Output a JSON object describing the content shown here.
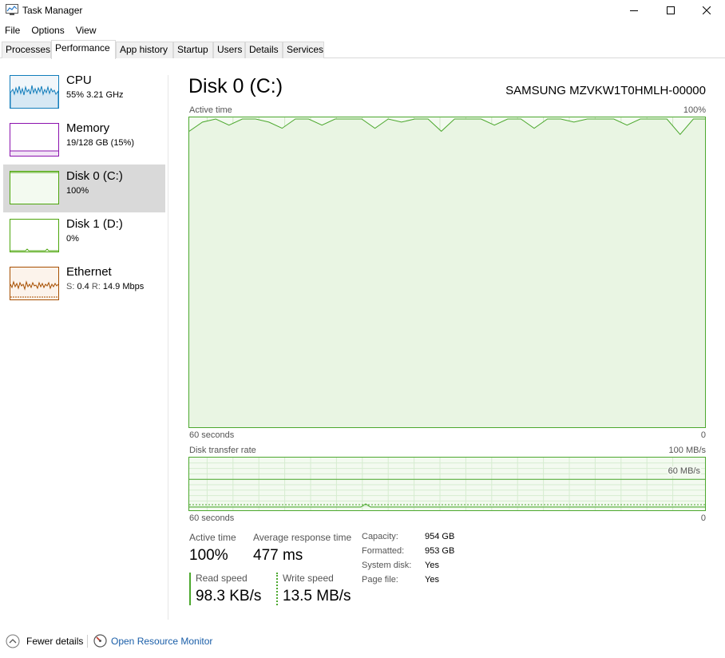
{
  "window": {
    "title": "Task Manager"
  },
  "menu": [
    "File",
    "Options",
    "View"
  ],
  "tabs": [
    "Processes",
    "Performance",
    "App history",
    "Startup",
    "Users",
    "Details",
    "Services"
  ],
  "active_tab": "Performance",
  "sidebar": {
    "items": [
      {
        "name": "CPU",
        "value": "55%  3.21 GHz",
        "color": "#117dbb"
      },
      {
        "name": "Memory",
        "value": "19/128 GB (15%)",
        "color": "#8b12ae"
      },
      {
        "name": "Disk 0 (C:)",
        "value": "100%",
        "color": "#4da60c",
        "selected": true
      },
      {
        "name": "Disk 1 (D:)",
        "value": "0%",
        "color": "#4da60c"
      },
      {
        "name": "Ethernet",
        "send_label": "S:",
        "send_value": "0.4",
        "recv_label": "R:",
        "recv_value": "14.9 Mbps",
        "color": "#a74f01"
      }
    ]
  },
  "main": {
    "title": "Disk 0 (C:)",
    "device": "SAMSUNG MZVKW1T0HMLH-00000",
    "active_time_graph": {
      "label": "Active time",
      "max_label": "100%",
      "time_label": "60 seconds",
      "min_label": "0",
      "values_percent": [
        96,
        99,
        100,
        98,
        100,
        100,
        99,
        97,
        100,
        100,
        98,
        100,
        100,
        100,
        97,
        100,
        99,
        100,
        100,
        96,
        100,
        100,
        100,
        98,
        100,
        100,
        97,
        100,
        100,
        99,
        100,
        100,
        100,
        98,
        100,
        100,
        100,
        95,
        100,
        100
      ]
    },
    "transfer_graph": {
      "label": "Disk transfer rate",
      "max_label": "100 MB/s",
      "inner_label": "60 MB/s",
      "time_label": "60 seconds",
      "min_label": "0"
    },
    "stats": {
      "active_time_label": "Active time",
      "active_time_value": "100%",
      "avg_response_label": "Average response time",
      "avg_response_value": "477 ms",
      "read_speed_label": "Read speed",
      "read_speed_value": "98.3 KB/s",
      "write_speed_label": "Write speed",
      "write_speed_value": "13.5 MB/s"
    },
    "details": [
      {
        "key": "Capacity:",
        "value": "954 GB"
      },
      {
        "key": "Formatted:",
        "value": "953 GB"
      },
      {
        "key": "System disk:",
        "value": "Yes"
      },
      {
        "key": "Page file:",
        "value": "Yes"
      }
    ]
  },
  "footer": {
    "fewer_details": "Fewer details",
    "resource_monitor": "Open Resource Monitor"
  },
  "colors": {
    "disk_green": "#4ca82e",
    "graph_fill": "#f3faf0",
    "selection": "#d9d9d9",
    "link": "#1a5ea8"
  }
}
